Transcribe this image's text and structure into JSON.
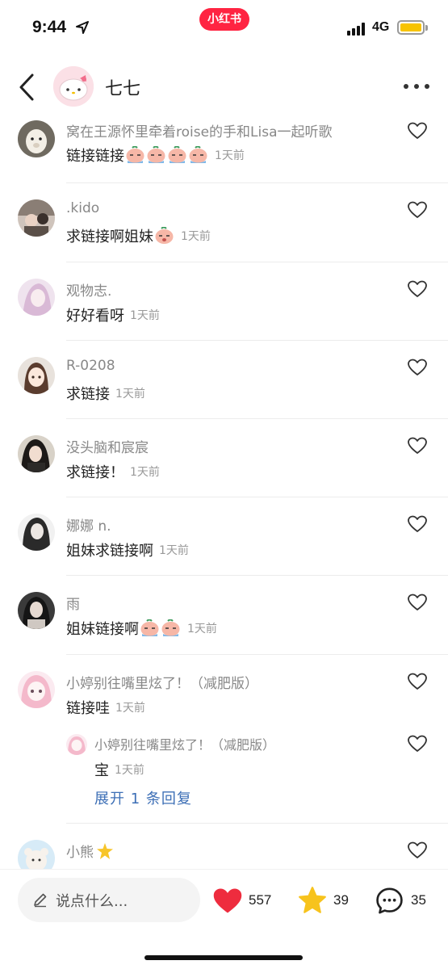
{
  "status_bar": {
    "time": "9:44",
    "network": "4G",
    "app_badge": "小红书"
  },
  "header": {
    "title": "七七"
  },
  "comments": [
    {
      "name": "窝在王源怀里牵着roise的手和Lisa一起听歌",
      "text": "链接链接",
      "emoji_count": 4,
      "time": "1天前"
    },
    {
      "name": ".kido",
      "text": "求链接啊姐妹",
      "emoji_count": 1,
      "time": "1天前"
    },
    {
      "name": "观物志.",
      "text": "好好看呀",
      "emoji_count": 0,
      "time": "1天前"
    },
    {
      "name": "R-0208",
      "text": "求链接",
      "emoji_count": 0,
      "time": "1天前"
    },
    {
      "name": "没头脑和宸宸",
      "text": "求链接！",
      "emoji_count": 0,
      "time": "1天前"
    },
    {
      "name": "娜娜 n.",
      "text": "姐妹求链接啊",
      "emoji_count": 0,
      "time": "1天前"
    },
    {
      "name": "雨",
      "text": "姐妹链接啊",
      "emoji_count": 2,
      "time": "1天前"
    },
    {
      "name": "小婷别往嘴里炫了！（减肥版）",
      "text": "链接哇",
      "emoji_count": 0,
      "time": "1天前",
      "reply": {
        "name": "小婷别往嘴里炫了！（减肥版）",
        "text": "宝",
        "time": "1天前"
      },
      "expand_label": "展开 1 条回复"
    },
    {
      "name": "小熊",
      "text": "",
      "emoji_count": 0,
      "time": ""
    }
  ],
  "bottom_bar": {
    "input_placeholder": "说点什么...",
    "likes": "557",
    "collects": "39",
    "comments": "35"
  },
  "colors": {
    "brand": "#ff2442",
    "like": "#ee2c3e",
    "collect": "#f7c31d",
    "link": "#3d6fb6"
  }
}
